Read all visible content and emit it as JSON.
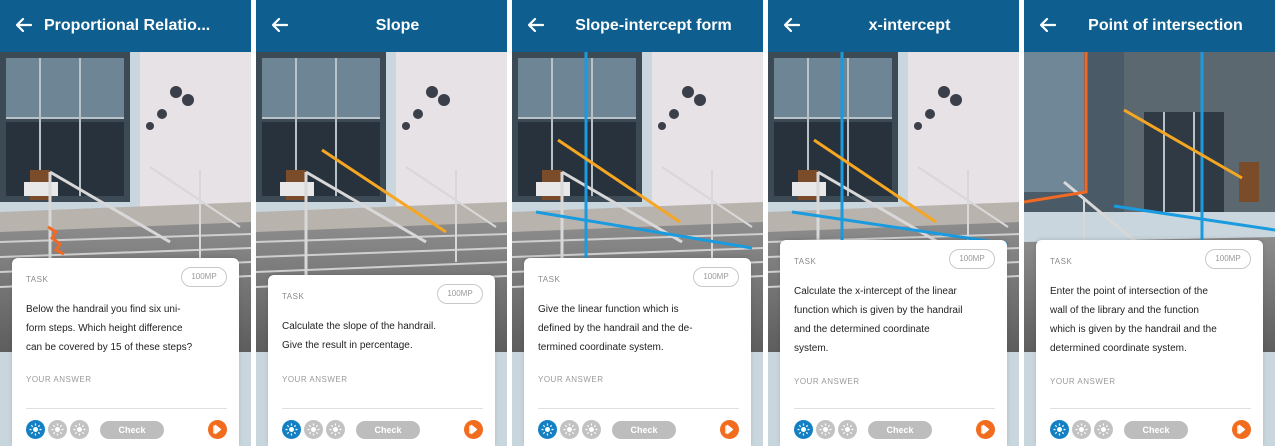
{
  "colors": {
    "header": "#0e5f8f",
    "handrail": "#f5a623",
    "axis": "#1a9be0",
    "wall_line": "#f06a25",
    "step_marker": "#f06a25",
    "hint_active": "#1480c4",
    "hint_inactive": "#c2c2c2",
    "check": "#bdbdbd",
    "skip": "#f26c1e"
  },
  "icons": {
    "back": "arrow-left-icon",
    "hint": "bulb-icon",
    "skip": "skip-forward-icon"
  },
  "panels": [
    {
      "title": "Proportional Relatio...",
      "task_label": "TASK",
      "points": "100MP",
      "question_lines": [
        "Below the handrail you find six uni-",
        "form steps. Which height difference",
        "can be covered by 15 of these steps?"
      ],
      "answer_label": "YOUR ANSWER",
      "check_label": "Check"
    },
    {
      "title": "Slope",
      "task_label": "TASK",
      "points": "100MP",
      "question_lines": [
        "Calculate the slope of the handrail.",
        "Give the result in percentage."
      ],
      "answer_label": "YOUR ANSWER",
      "check_label": "Check"
    },
    {
      "title": "Slope-intercept form",
      "task_label": "TASK",
      "points": "100MP",
      "question_lines": [
        "Give the linear function which is",
        "defined by the handrail and the de-",
        "termined coordinate system."
      ],
      "answer_label": "YOUR ANSWER",
      "check_label": "Check"
    },
    {
      "title": "x-intercept",
      "task_label": "TASK",
      "points": "100MP",
      "question_lines": [
        "Calculate the x-intercept of the linear",
        "function which is given by the handrail",
        "and the determined coordinate",
        "system."
      ],
      "answer_label": "YOUR ANSWER",
      "check_label": "Check"
    },
    {
      "title": "Point of intersection",
      "task_label": "TASK",
      "points": "100MP",
      "question_lines": [
        "Enter the point of intersection of the",
        "wall of the library and the function",
        "which is given by the handrail and the",
        "determined coordinate system."
      ],
      "answer_label": "YOUR ANSWER",
      "check_label": "Check"
    }
  ]
}
